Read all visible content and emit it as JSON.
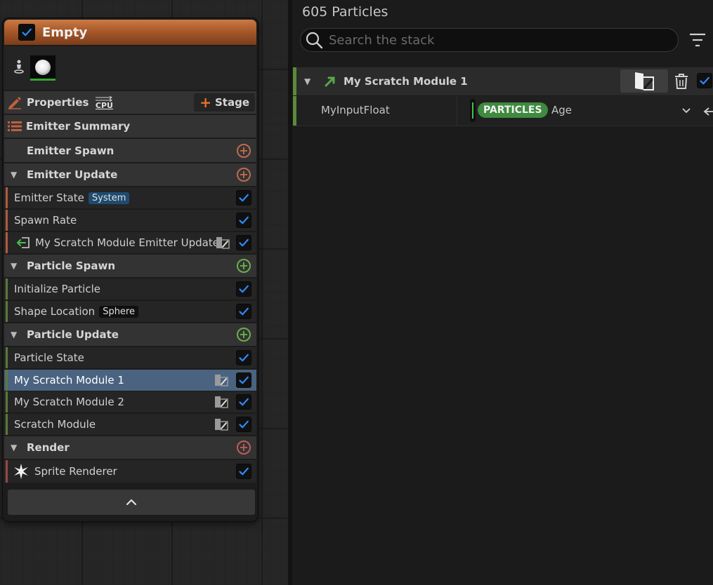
{
  "node": {
    "title": "Empty",
    "properties_label": "Properties",
    "sim_target": "CPU",
    "stage_label": "Stage",
    "summary_label": "Emitter Summary",
    "sections": [
      {
        "label": "Emitter Spawn"
      },
      {
        "label": "Emitter Update"
      },
      {
        "label": "Particle Spawn"
      },
      {
        "label": "Particle Update"
      },
      {
        "label": "Render"
      }
    ],
    "items": [
      {
        "label": "Emitter State",
        "badge": "System"
      },
      {
        "label": "Spawn Rate"
      },
      {
        "label": "My Scratch Module Emitter Update"
      },
      {
        "label": "Initialize Particle"
      },
      {
        "label": "Shape Location",
        "badge": "Sphere"
      },
      {
        "label": "Particle State"
      },
      {
        "label": "My Scratch Module 1"
      },
      {
        "label": "My Scratch Module 2"
      },
      {
        "label": "Scratch Module"
      },
      {
        "label": "Sprite Renderer"
      }
    ],
    "collapse_glyph": "︿"
  },
  "panel": {
    "particle_count": "605 Particles",
    "search_placeholder": "Search the stack",
    "module_title": "My Scratch Module 1",
    "param_name": "MyInputFloat",
    "namespace": "PARTICLES",
    "attribute": "Age"
  },
  "colors": {
    "accent_blue": "#1f8fff",
    "header_orange": "#a8592a",
    "selected_row": "#4a6380",
    "particle_green": "#3f8a3f"
  }
}
